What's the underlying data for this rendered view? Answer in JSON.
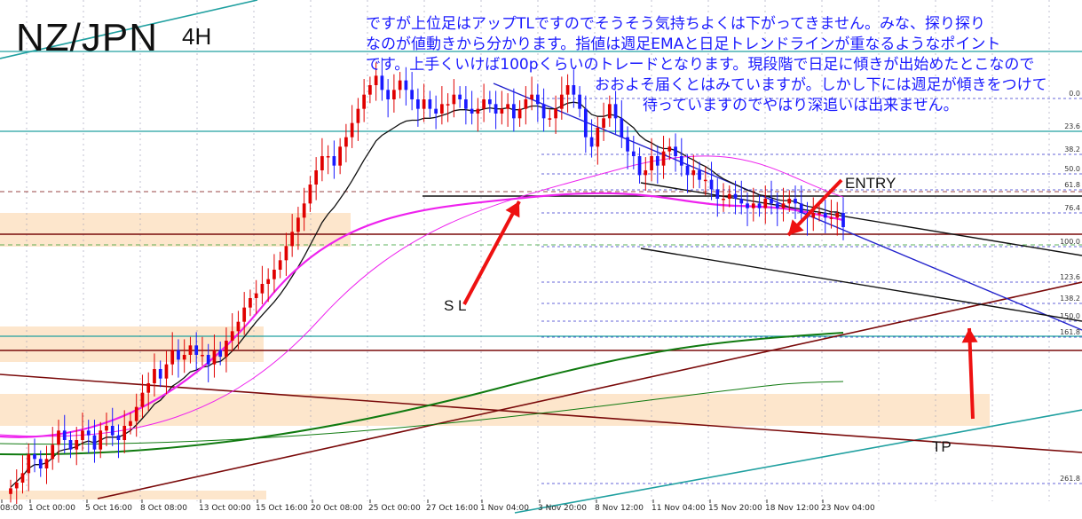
{
  "title": {
    "pair": "NZ/JPN",
    "timeframe": "4H"
  },
  "comment": {
    "lines": [
      "ですが上位足はアップTLですのでそうそう気持ちよくは下がってきません。みな、探り探り",
      "なのが値動きから分かります。指値は週足EMAと日足トレンドラインが重なるようなポイント",
      "です。上手くいけば100pくらいのトレードとなります。現段階で日足に傾きが出始めたとこなので",
      "おおよそ届くとはみていますが。しかし下には週足が傾きをつけて",
      "待っていますのでやはり深追いは出来ません。"
    ]
  },
  "annotations": {
    "entry": "ENTRY",
    "sl": "S L",
    "tp": "TP"
  },
  "colors": {
    "bull": "#e00000",
    "bear": "#1a1aff",
    "arrow": "#ee1111",
    "zone": "#fde6cc",
    "magenta": "#ee22ee",
    "green": "#107a10",
    "maroon": "#7a0a0a",
    "teal": "#20a0a0",
    "fib": "#3333cc"
  },
  "chart_data": {
    "type": "candlestick",
    "x_ticks": [
      "08:00",
      "1 Oct 00:00",
      "5 Oct 16:00",
      "8 Oct 08:00",
      "13 Oct 00:00",
      "15 Oct 16:00",
      "20 Oct 08:00",
      "25 Oct 00:00",
      "27 Oct 16:00",
      "1 Nov 04:00",
      "3 Nov 20:00",
      "8 Nov 12:00",
      "11 Nov 04:00",
      "15 Nov 20:00",
      "18 Nov 12:00",
      "23 Nov 04:00"
    ],
    "fib_levels": [
      "0.0",
      "23.6",
      "38.2",
      "50.0",
      "61.8",
      "76.4",
      "100.0",
      "123.6",
      "138.2",
      "150.0",
      "161.8",
      "261.8"
    ],
    "closes": [
      0.9,
      1.5,
      2.5,
      4.5,
      4.0,
      3.0,
      4.0,
      5.5,
      7.0,
      6.0,
      5.0,
      6.0,
      7.0,
      6.5,
      5.0,
      7.0,
      7.5,
      6.5,
      6.0,
      7.5,
      8.0,
      9.5,
      11.0,
      12.0,
      13.5,
      12.5,
      14.0,
      15.5,
      14.5,
      15.0,
      16.0,
      15.0,
      15.0,
      14.0,
      15.5,
      14.8,
      16.5,
      17.5,
      18.5,
      20.0,
      21.0,
      21.5,
      22.5,
      23.0,
      24.0,
      25.0,
      26.5,
      28.0,
      29.5,
      31.0,
      33.0,
      34.5,
      36.0,
      36.0,
      35.0,
      37.0,
      38.0,
      39.5,
      41.0,
      42.5,
      43.5,
      44.5,
      43.0,
      42.0,
      43.0,
      44.0,
      43.0,
      42.0,
      41.0,
      42.0,
      41.0,
      40.5,
      41.5,
      41.5,
      42.5,
      42.0,
      41.0,
      40.5,
      41.0,
      42.0,
      41.5,
      40.5,
      41.0,
      41.5,
      40.0,
      41.0,
      42.0,
      42.5,
      41.5,
      40.0,
      40.0,
      41.0,
      42.5,
      43.5,
      42.5,
      41.0,
      38.0,
      37.0,
      39.0,
      40.0,
      41.5,
      40.0,
      38.0,
      36.5,
      36.0,
      34.0,
      34.5,
      36.0,
      35.0,
      36.5,
      37.0,
      36.0,
      35.0,
      34.0,
      34.5,
      33.5,
      33.5,
      32.5,
      31.5,
      31.5,
      32.0,
      31.5,
      31.0,
      30.5,
      31.0,
      30.5,
      31.5,
      31.0,
      30.5,
      31.0,
      31.5,
      31.0,
      30.0,
      29.5,
      30.0,
      30.0,
      29.5,
      29.5,
      30.0,
      28.5
    ],
    "ema_fast": [
      1,
      1.6,
      2.2,
      3,
      3.4,
      3.4,
      3.6,
      4.1,
      4.8,
      5,
      5.1,
      5.3,
      5.7,
      5.9,
      5.7,
      6,
      6.3,
      6.3,
      6.3,
      6.6,
      7,
      7.6,
      8.3,
      9,
      9.8,
      10.2,
      10.9,
      11.7,
      12.1,
      12.6,
      13.2,
      13.4,
      13.7,
      13.8,
      14.2,
      14.3,
      14.8,
      15.4,
      16.1,
      16.9,
      17.7,
      18.5,
      19.2,
      19.9,
      20.6,
      21.4,
      22.3,
      23.3,
      24.3,
      25.4,
      26.6,
      27.8,
      29,
      29.9,
      30.6,
      31.5,
      32.4,
      33.4,
      34.5,
      35.6,
      36.6,
      37.6,
      38.2,
      38.6,
      39,
      39.4,
      39.7,
      39.8,
      39.8,
      40,
      40,
      40.1,
      40.3,
      40.5,
      40.8,
      40.9,
      40.9,
      40.8,
      40.8,
      41,
      41.1,
      41,
      41,
      41.1,
      40.9,
      40.9,
      41.1,
      41.3,
      41.3,
      41.1,
      41,
      41,
      41.3,
      41.6,
      41.7,
      41.6,
      41,
      40.4,
      40.2,
      40.2,
      40.4,
      40.3,
      40,
      39.5,
      39,
      38.2,
      37.7,
      37.4,
      37,
      36.8,
      36.8,
      36.6,
      36.3,
      35.9,
      35.6,
      35.2,
      34.9,
      34.5,
      34,
      33.6,
      33.3,
      33,
      32.7,
      32.4,
      32.2,
      31.9,
      31.8,
      31.6,
      31.4,
      31.3,
      31.3,
      31.2,
      30.9,
      30.7,
      30.6,
      30.5,
      30.3,
      30.1,
      30.1,
      29.8
    ]
  }
}
